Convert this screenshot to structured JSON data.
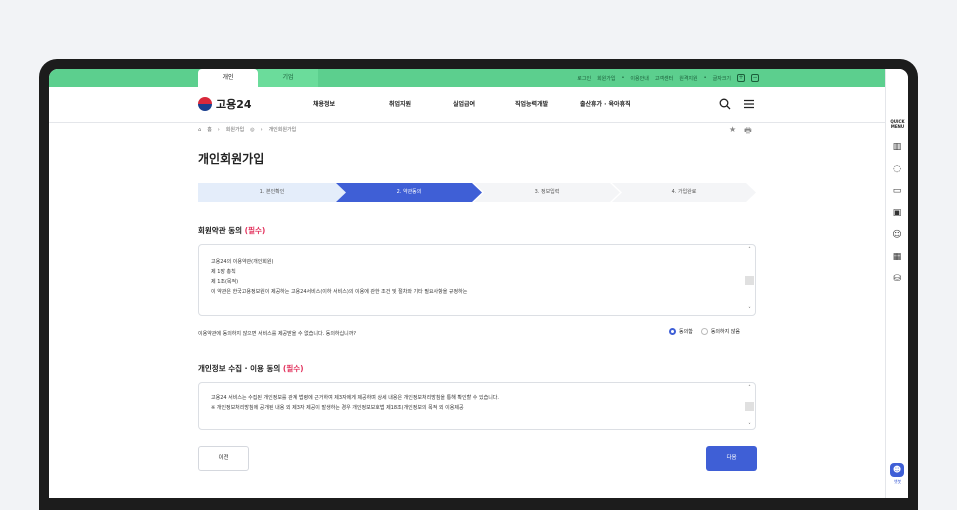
{
  "topbar": {
    "tabs": [
      "개인",
      "기업"
    ],
    "links": [
      "로그인",
      "회원가입",
      "이용안내",
      "고객센터",
      "원격지원",
      "글자크기"
    ],
    "zoom_in": "+",
    "zoom_out": "−"
  },
  "gnb": {
    "logo": "고용24",
    "menu": [
      "채용정보",
      "취업지원",
      "실업급여",
      "직업능력개발",
      "출산휴가 · 육아휴직"
    ],
    "search_icon": "search-icon",
    "menu_icon": "hamburger-icon"
  },
  "breadcrumb": [
    "홈",
    "회원가입",
    "개인회원가입"
  ],
  "page_title": "개인회원가입",
  "steps": [
    "1. 본인확인",
    "2. 약관동의",
    "3. 정보입력",
    "4. 가입완료"
  ],
  "terms": {
    "title": "회원약관 동의",
    "required": "(필수)",
    "lines": [
      "고용24의 이용약관(개인회원)",
      "제 1장 총칙",
      "제 1조(목적)",
      "이 약관은 한국고용정보원이 제공하는 고용24서비스(이하 서비스)의 이용에 관한 조건 및 절차와 기타 필요사항을 규정하는"
    ],
    "question": "이용약관에 동의하지 않으면 서비스를 제공받을 수 없습니다.  동의하십니까?",
    "agree": "동의함",
    "disagree": "동의하지 않음"
  },
  "privacy": {
    "title": "개인정보 수집 · 이용 동의",
    "required": "(필수)",
    "lines": [
      "고용24 서비스는 수집된 개인정보를 관계 법령에 근거하여 제3자에게 제공하며 상세 내용은 개인정보처리방침을 통해 확인할 수 있습니다.",
      "※ 개인정보처리방침에 공개된 내용 외 제3자 제공이 발생하는 경우 개인정보보호법 제18조(개인정보의 목적 외 이용제공"
    ]
  },
  "buttons": {
    "prev": "이전",
    "next": "다음"
  },
  "quick_menu": {
    "title": "QUICK MENU",
    "bot_label": "챗봇"
  },
  "colors": {
    "green": "#5ccf8e",
    "blue": "#3f5fd6",
    "required": "#e2315c"
  }
}
